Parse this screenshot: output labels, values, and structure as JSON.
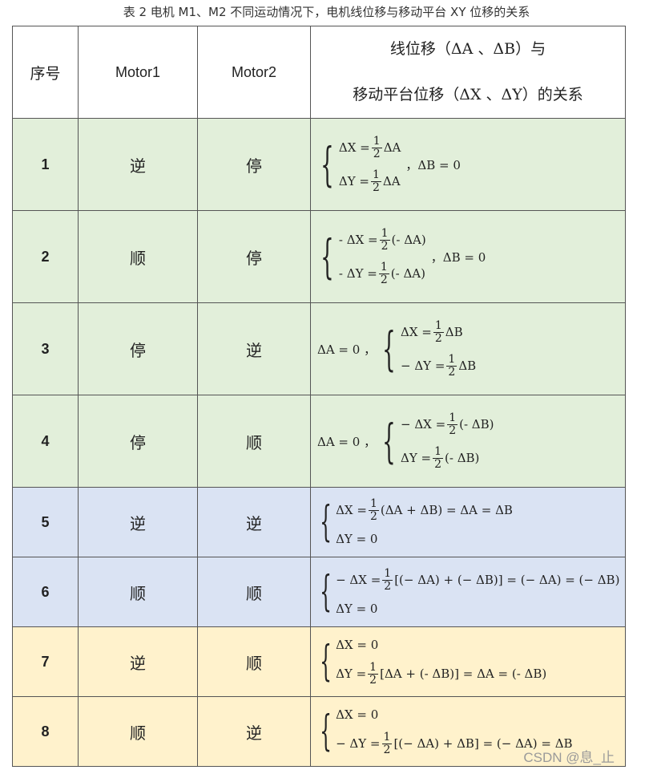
{
  "caption": "表 2 电机 M1、M2 不同运动情况下，电机线位移与移动平台 XY 位移的关系",
  "header": {
    "index": "序号",
    "motor1": "Motor1",
    "motor2": "Motor2",
    "relation_line1": "线位移（ΔA 、ΔB）与",
    "relation_line2": "移动平台位移（ΔX 、ΔY）的关系"
  },
  "rows": [
    {
      "index": "1",
      "motor1": "逆",
      "motor2": "停",
      "color": "#e2efda",
      "l1a": "ΔX =",
      "l1b": "ΔA",
      "l2a": "ΔY =",
      "l2b": "ΔA",
      "post": "，ΔB = 0"
    },
    {
      "index": "2",
      "motor1": "顺",
      "motor2": "停",
      "color": "#e2efda",
      "l1a": "- ΔX =",
      "l1b": "(- ΔA)",
      "l2a": "- ΔY =",
      "l2b": "(- ΔA)",
      "post": "，ΔB = 0"
    },
    {
      "index": "3",
      "motor1": "停",
      "motor2": "逆",
      "color": "#e2efda",
      "pre": "ΔA = 0 ，",
      "l1a": "ΔX =",
      "l1b": "ΔB",
      "l2a": "− ΔY =",
      "l2b": "ΔB"
    },
    {
      "index": "4",
      "motor1": "停",
      "motor2": "顺",
      "color": "#e2efda",
      "pre": "ΔA = 0 ，",
      "l1a": "− ΔX =",
      "l1b": "(- ΔB)",
      "l2a": "ΔY =",
      "l2b": "(- ΔB)"
    },
    {
      "index": "5",
      "motor1": "逆",
      "motor2": "逆",
      "color": "#dae3f3",
      "l1a": "ΔX =",
      "l1b": "(ΔA + ΔB) = ΔA = ΔB",
      "l2": "ΔY = 0"
    },
    {
      "index": "6",
      "motor1": "顺",
      "motor2": "顺",
      "color": "#dae3f3",
      "l1a": "− ΔX =",
      "l1b": "[(− ΔA) + (− ΔB)] = (− ΔA) = (− ΔB)",
      "l2": "ΔY = 0"
    },
    {
      "index": "7",
      "motor1": "逆",
      "motor2": "顺",
      "color": "#fff2cc",
      "l1": "ΔX = 0",
      "l2a": "ΔY =",
      "l2b": "[ΔA + (- ΔB)] = ΔA = (- ΔB)"
    },
    {
      "index": "8",
      "motor1": "顺",
      "motor2": "逆",
      "color": "#fff2cc",
      "l1": "ΔX = 0",
      "l2a": "− ΔY =",
      "l2b": "[(− ΔA) + ΔB] = (− ΔA) = ΔB"
    }
  ],
  "fraction": {
    "num": "1",
    "den": "2"
  },
  "watermark": "CSDN @息_止"
}
